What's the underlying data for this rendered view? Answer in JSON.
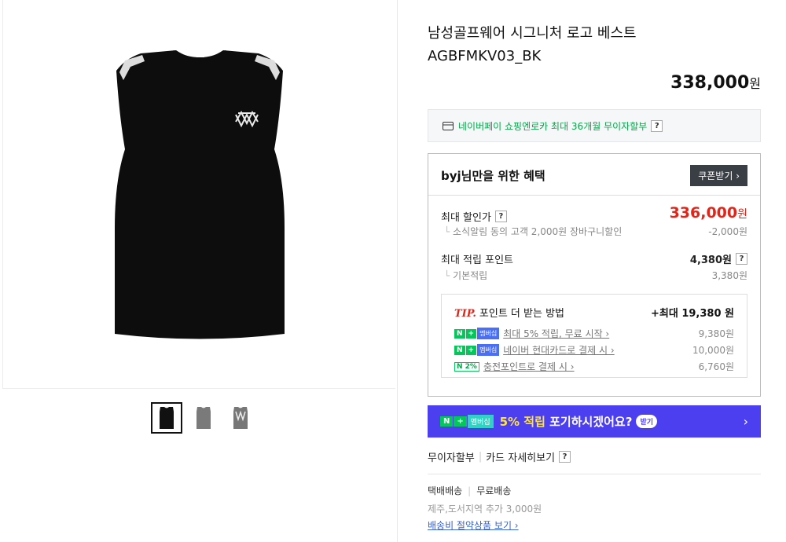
{
  "product": {
    "title_line1": "남성골프웨어 시그니처 로고 베스트",
    "title_line2": "AGBFMKV03_BK",
    "price_amount": "338,000",
    "price_unit": "원"
  },
  "npay": {
    "text": "네이버페이 쇼핑엔로카 최대 36개월 무이자할부",
    "help": "?"
  },
  "benefits": {
    "heading": "byj님만을 위한 혜택",
    "coupon_button": "쿠폰받기 ›",
    "max_discount_label": "최대 할인가",
    "max_discount_amount": "336,000",
    "max_discount_unit": "원",
    "max_discount_sub_label": "소식알림 동의 고객 2,000원 장바구니할인",
    "max_discount_sub_value": "-2,000원",
    "max_point_label": "최대 적립 포인트",
    "max_point_value": "4,380원",
    "basic_point_label": "기본적립",
    "basic_point_value": "3,380원",
    "help": "?"
  },
  "tip": {
    "tip_word": "TIP.",
    "title": "포인트 더 받는 방법",
    "total": "+최대 19,380 원",
    "rows": [
      {
        "badge_n": "N",
        "badge_plus": "+",
        "badge_mem": "멤버십",
        "link": "최대 5% 적립, 무료 시작 ›",
        "value": "9,380원"
      },
      {
        "badge_n": "N",
        "badge_plus": "+",
        "badge_mem": "멤버십",
        "link": "네이버 현대카드로 결제 시 ›",
        "value": "10,000원"
      },
      {
        "badge_2p": "N 2%",
        "link": "충전포인트로 결제 시 ›",
        "value": "6,760원"
      }
    ]
  },
  "banner": {
    "badge_n": "N",
    "badge_plus": "+",
    "badge_mem": "멤버십",
    "highlight": "5% 적립",
    "text": " 포기하시겠어요?",
    "pill": "받기",
    "arrow": "›",
    "bg_color": "#4c3ff0"
  },
  "install": {
    "label1": "무이자할부",
    "label2": "카드 자세히보기",
    "help": "?"
  },
  "shipping": {
    "method": "택배배송",
    "fee": "무료배송",
    "extra": "제주,도서지역 추가 3,000원",
    "link": "배송비 절약상품 보기 ›"
  },
  "colors": {
    "accent_red": "#e0251a",
    "naver_green": "#03c75a"
  }
}
